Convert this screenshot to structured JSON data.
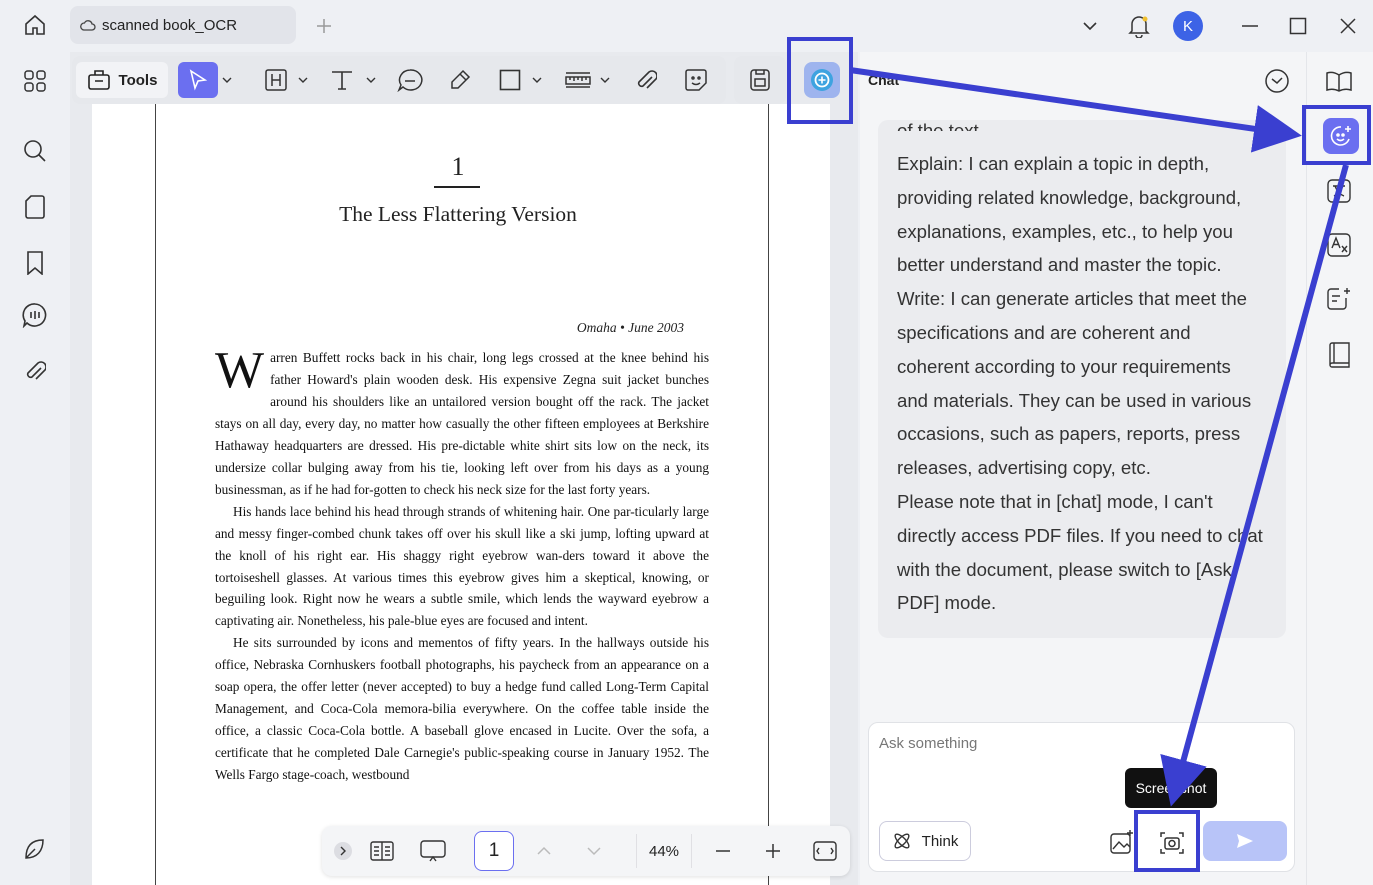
{
  "tab": {
    "title": "scanned book_OCR",
    "lock_icon": "cloud-icon"
  },
  "titlebar": {
    "avatar": "K",
    "accent": "#3d63e6"
  },
  "toolbar": {
    "tools_label": "Tools"
  },
  "book": {
    "chapter_number": "1",
    "chapter_title": "The Less Flattering Version",
    "dateline": "Omaha • June 2003",
    "dropcap": "W",
    "paragraphs": [
      "arren Buffett rocks back in his chair, long legs crossed at the knee behind his father Howard's plain wooden desk. His expensive Zegna suit jacket bunches around his shoulders like an untailored version bought off the rack. The jacket stays on all day, every day, no matter how casually the other fifteen employees at Berkshire Hathaway headquarters are dressed. His pre-dictable white shirt sits low on the neck, its undersize collar bulging away from his tie, looking left over from his days as a young businessman, as if he had for-gotten to check his neck size for the last forty years.",
      "His hands lace behind his head through strands of whitening hair. One par-ticularly large and messy finger-combed chunk takes off over his skull like a ski jump, lofting upward at the knoll of his right ear. His shaggy right eyebrow wan-ders toward it above the tortoiseshell glasses. At various times this eyebrow gives him a skeptical, knowing, or beguiling look. Right now he wears a subtle smile, which lends the wayward eyebrow a captivating air. Nonetheless, his pale-blue eyes are focused and intent.",
      "He sits surrounded by icons and mementos of fifty years. In the hallways outside his office, Nebraska Cornhuskers football photographs, his paycheck from an appearance on a soap opera, the offer letter (never accepted) to buy a hedge fund called Long-Term Capital Management, and Coca-Cola memora-bilia everywhere. On the coffee table inside the office, a classic Coca-Cola bottle. A baseball glove encased in Lucite. Over the sofa, a certificate that he completed Dale Carnegie's public-speaking course in January 1952. The Wells Fargo stage-coach, westbound"
    ]
  },
  "chat": {
    "header": "Chat",
    "lines": [
      "of the text.",
      "Explain: I can explain a topic in depth,",
      "providing related knowledge, background,",
      "explanations, examples, etc., to help you",
      "better understand and master the topic.",
      "Write: I can generate articles that meet the",
      "specifications and are coherent and",
      "coherent according to your requirements",
      "and materials. They can be used in various",
      "occasions, such as papers, reports, press",
      "releases, advertising copy, etc.",
      "Please note that in [chat] mode, I can't",
      "directly access PDF files. If you need to chat",
      "with the document, please switch to [Ask",
      "PDF] mode."
    ],
    "input_placeholder": "Ask something",
    "think_label": "Think",
    "tooltip": "Screenshot"
  },
  "bottom": {
    "page_number": "1",
    "zoom": "44%"
  },
  "colors": {
    "highlight": "#3a3fd0",
    "ai_button": "#6b6ff0",
    "send_button": "#b8c4f8"
  }
}
